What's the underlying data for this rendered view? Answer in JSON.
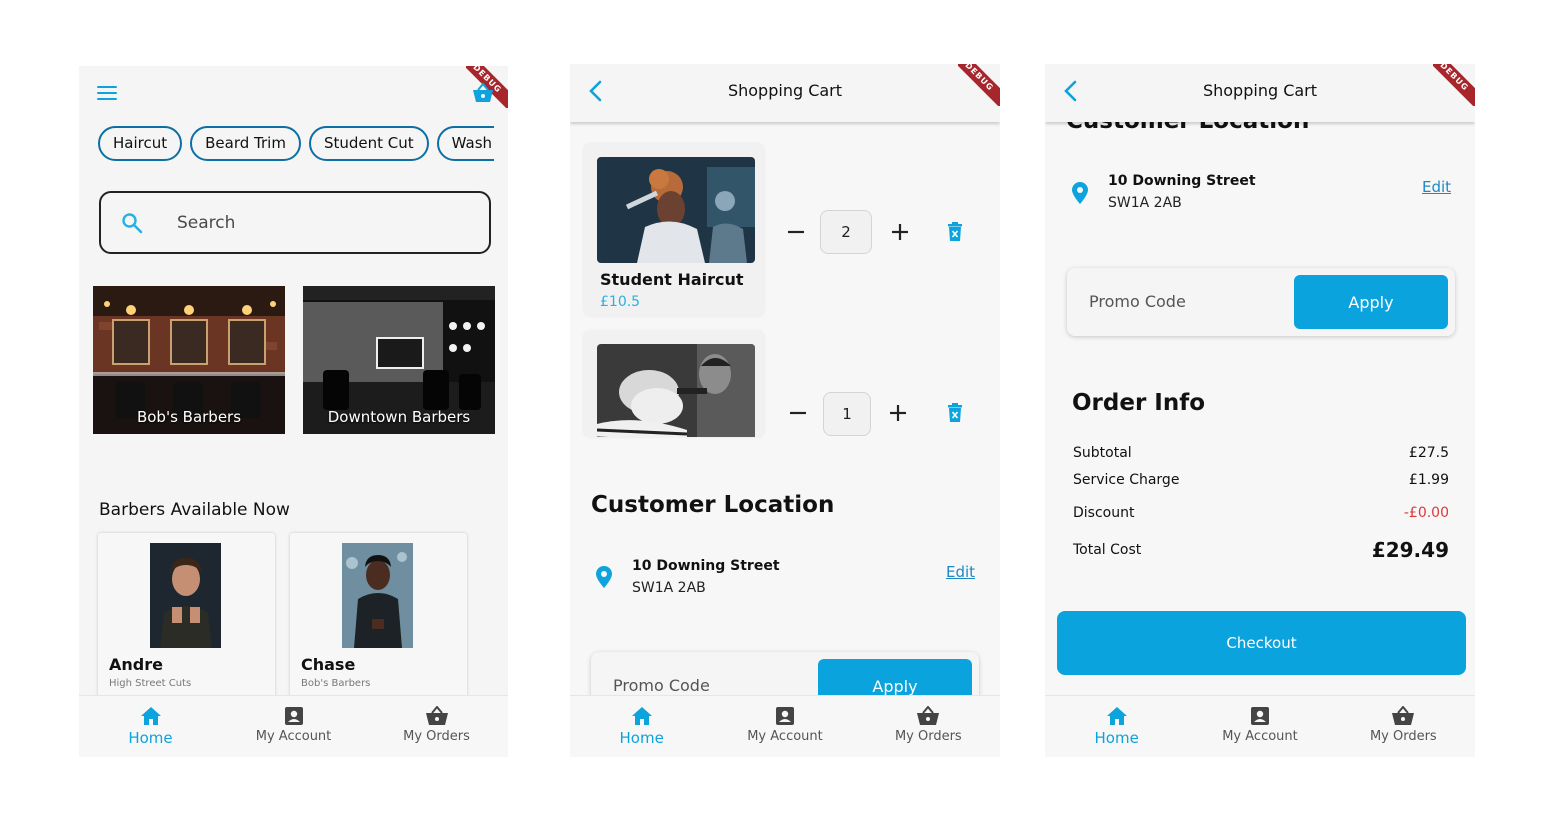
{
  "colors": {
    "accent": "#0aa3dd",
    "danger": "#d93b3b",
    "link": "#1e88c7",
    "debug_ribbon": "#a7262b"
  },
  "debug_banner": "DEBUG",
  "home": {
    "categories": [
      "Haircut",
      "Beard Trim",
      "Student Cut",
      "Wash &"
    ],
    "search_placeholder": "Search",
    "shops": [
      {
        "name": "Bob's Barbers",
        "image": "barbershop-interior"
      },
      {
        "name": "Downtown Barbers",
        "image": "barbershop-bw-interior"
      }
    ],
    "section_title": "Barbers Available Now",
    "barbers": [
      {
        "name": "Andre",
        "shop": "High Street Cuts"
      },
      {
        "name": "Chase",
        "shop": "Bob's Barbers"
      }
    ]
  },
  "cart": {
    "title": "Shopping Cart",
    "items": [
      {
        "name": "Student Haircut",
        "price": "£10.5",
        "qty": "2"
      },
      {
        "name": "",
        "price": "",
        "qty": "1"
      }
    ],
    "location_heading": "Customer Location",
    "location_heading_clipped": "Customer Location",
    "address_line1": "10 Downing Street",
    "address_line2": "SW1A 2AB",
    "edit_label": "Edit",
    "promo_placeholder": "Promo Code",
    "apply_label": "Apply"
  },
  "order": {
    "heading": "Order Info",
    "subtotal_label": "Subtotal",
    "subtotal": "£27.5",
    "service_label": "Service Charge",
    "service": "£1.99",
    "discount_label": "Discount",
    "discount": "-£0.00",
    "total_label": "Total Cost",
    "total": "£29.49",
    "checkout_label": "Checkout"
  },
  "nav": {
    "home": "Home",
    "account": "My Account",
    "orders": "My Orders"
  }
}
